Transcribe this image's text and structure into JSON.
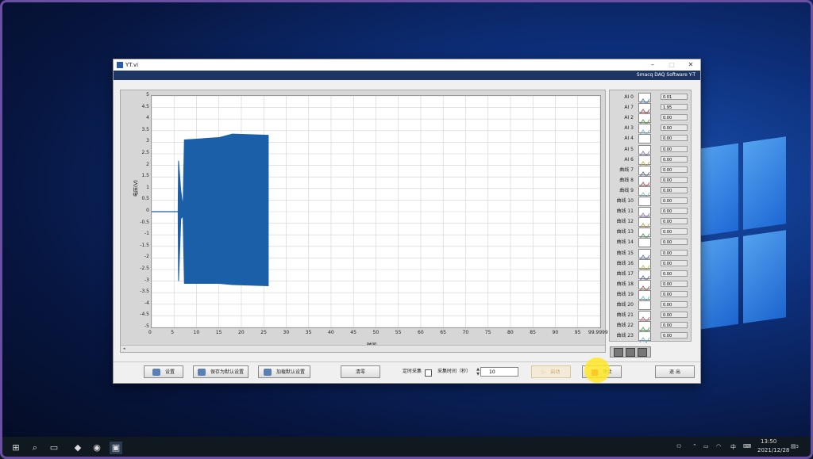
{
  "window": {
    "title": "YT.vi",
    "brand": "Smacq DAQ Software Y-T",
    "controls": [
      "–",
      "□",
      "✕"
    ]
  },
  "graph": {
    "ylabel": "电压(V)",
    "xlabel": "时间",
    "yticks": [
      "5",
      "4.5",
      "4",
      "3.5",
      "3",
      "2.5",
      "2",
      "1.5",
      "1",
      "0.5",
      "0",
      "-0.5",
      "-1",
      "-1.5",
      "-2",
      "-2.5",
      "-3",
      "-3.5",
      "-4",
      "-4.5",
      "-5"
    ],
    "xticks": [
      "0",
      "5",
      "10",
      "15",
      "20",
      "25",
      "30",
      "35",
      "40",
      "45",
      "50",
      "55",
      "60",
      "65",
      "70",
      "75",
      "80",
      "85",
      "90",
      "95",
      "99.9999"
    ],
    "scroll_label": "◂"
  },
  "chart_data": {
    "type": "line",
    "x_range": [
      0,
      99.9999
    ],
    "ylim": [
      -5,
      5
    ],
    "grid": true,
    "series": [
      {
        "name": "AI 0",
        "color": "#1a5fa8",
        "signal": [
          {
            "x": 0,
            "y_min": 0,
            "y_max": 0
          },
          {
            "x": 5.9,
            "y_min": 0,
            "y_max": 0
          },
          {
            "x": 6.0,
            "y_min": -3.0,
            "y_max": 2.2
          },
          {
            "x": 6.5,
            "y_min": -0.3,
            "y_max": 0.9
          },
          {
            "x": 7.0,
            "y_min": -0.2,
            "y_max": 0.2
          },
          {
            "x": 7.3,
            "y_min": -3.1,
            "y_max": 3.1
          },
          {
            "x": 15,
            "y_min": -3.1,
            "y_max": 3.2
          },
          {
            "x": 18,
            "y_min": -3.15,
            "y_max": 3.35
          },
          {
            "x": 26,
            "y_min": -3.2,
            "y_max": 3.3
          }
        ]
      }
    ]
  },
  "channels": [
    {
      "name": "AI 0",
      "value": "0.01",
      "color": "#4a7fc0"
    },
    {
      "name": "AI 7",
      "value": "1.95",
      "color": "#c0504d"
    },
    {
      "name": "AI 2",
      "value": "0.00",
      "color": "#5aa84a"
    },
    {
      "name": "AI 3",
      "value": "0.00",
      "color": "#6fb8d6"
    },
    {
      "name": "AI 4",
      "value": "0.00",
      "color": "#ffffff"
    },
    {
      "name": "AI 5",
      "value": "0.00",
      "color": "#8e7fc0"
    },
    {
      "name": "AI 6",
      "value": "0.00",
      "color": "#c8b24a"
    },
    {
      "name": "曲线 7",
      "value": "0.00",
      "color": "#6070a0"
    },
    {
      "name": "曲线 8",
      "value": "0.00",
      "color": "#c06060"
    },
    {
      "name": "曲线 9",
      "value": "0.00",
      "color": "#80c0d0"
    },
    {
      "name": "曲线 10",
      "value": "0.00",
      "color": "#ffffff"
    },
    {
      "name": "曲线 11",
      "value": "0.00",
      "color": "#a080c0"
    },
    {
      "name": "曲线 12",
      "value": "0.00",
      "color": "#c0a050"
    },
    {
      "name": "曲线 13",
      "value": "0.00",
      "color": "#50a060"
    },
    {
      "name": "曲线 14",
      "value": "0.00",
      "color": "#ffffff"
    },
    {
      "name": "曲线 15",
      "value": "0.00",
      "color": "#6080c0"
    },
    {
      "name": "曲线 16",
      "value": "0.00",
      "color": "#c0c050"
    },
    {
      "name": "曲线 17",
      "value": "0.00",
      "color": "#6070a0"
    },
    {
      "name": "曲线 18",
      "value": "0.00",
      "color": "#b06060"
    },
    {
      "name": "曲线 19",
      "value": "0.00",
      "color": "#70c0d0"
    },
    {
      "name": "曲线 20",
      "value": "0.00",
      "color": "#ffffff"
    },
    {
      "name": "曲线 21",
      "value": "0.00",
      "color": "#c07090"
    },
    {
      "name": "曲线 22",
      "value": "0.00",
      "color": "#60b060"
    },
    {
      "name": "曲线 23",
      "value": "0.00",
      "color": "#70b0d0"
    }
  ],
  "controls": {
    "settings": "设置",
    "save_default": "保存为默认设置",
    "load_default": "加载默认设置",
    "clear": "清零",
    "timed_acq": "定时采集",
    "acq_time_label": "采集时间（秒）",
    "acq_time_value": "10",
    "start": "启动",
    "stop": "停止",
    "exit": "退 出"
  },
  "taskbar": {
    "time": "13:50",
    "date": "2021/12/28",
    "ime": "中",
    "notification_count": "3"
  }
}
